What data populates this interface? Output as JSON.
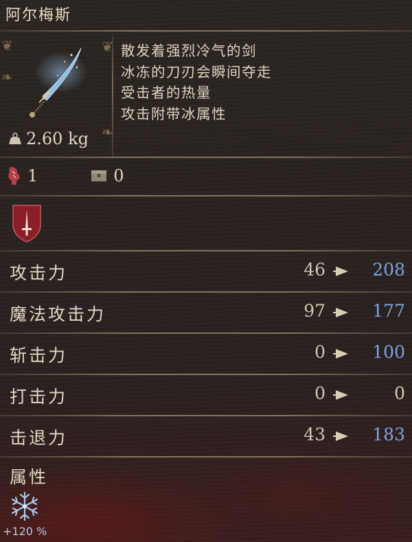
{
  "item": {
    "name": "阿尔梅斯",
    "weight": "2.60 kg",
    "weight_icon": "weight-icon",
    "image_icon": "frost-sword-icon",
    "description": [
      "散发着强烈冷气的剑",
      "冰冻的刀刃会瞬间夺走",
      "受击者的热量",
      "攻击附带冰属性"
    ]
  },
  "requirements": [
    {
      "icon": "strength-hand-icon",
      "value": "1"
    },
    {
      "icon": "chest-icon",
      "value": "0"
    }
  ],
  "weapon_class_icon": "sword-shield-icon",
  "stats": [
    {
      "label": "攻击力",
      "base": "46",
      "new": "208",
      "changed": true
    },
    {
      "label": "魔法攻击力",
      "base": "97",
      "new": "177",
      "changed": true
    },
    {
      "label": "斩击力",
      "base": "0",
      "new": "100",
      "changed": true
    },
    {
      "label": "打击力",
      "base": "0",
      "new": "0",
      "changed": false
    },
    {
      "label": "击退力",
      "base": "43",
      "new": "183",
      "changed": true
    }
  ],
  "attribute": {
    "label": "属性",
    "icon": "frost-icon",
    "value": "+120 %"
  },
  "colors": {
    "increase": "#7fa3df",
    "text": "#e2d8c2",
    "frost": "#b9c9e6"
  }
}
